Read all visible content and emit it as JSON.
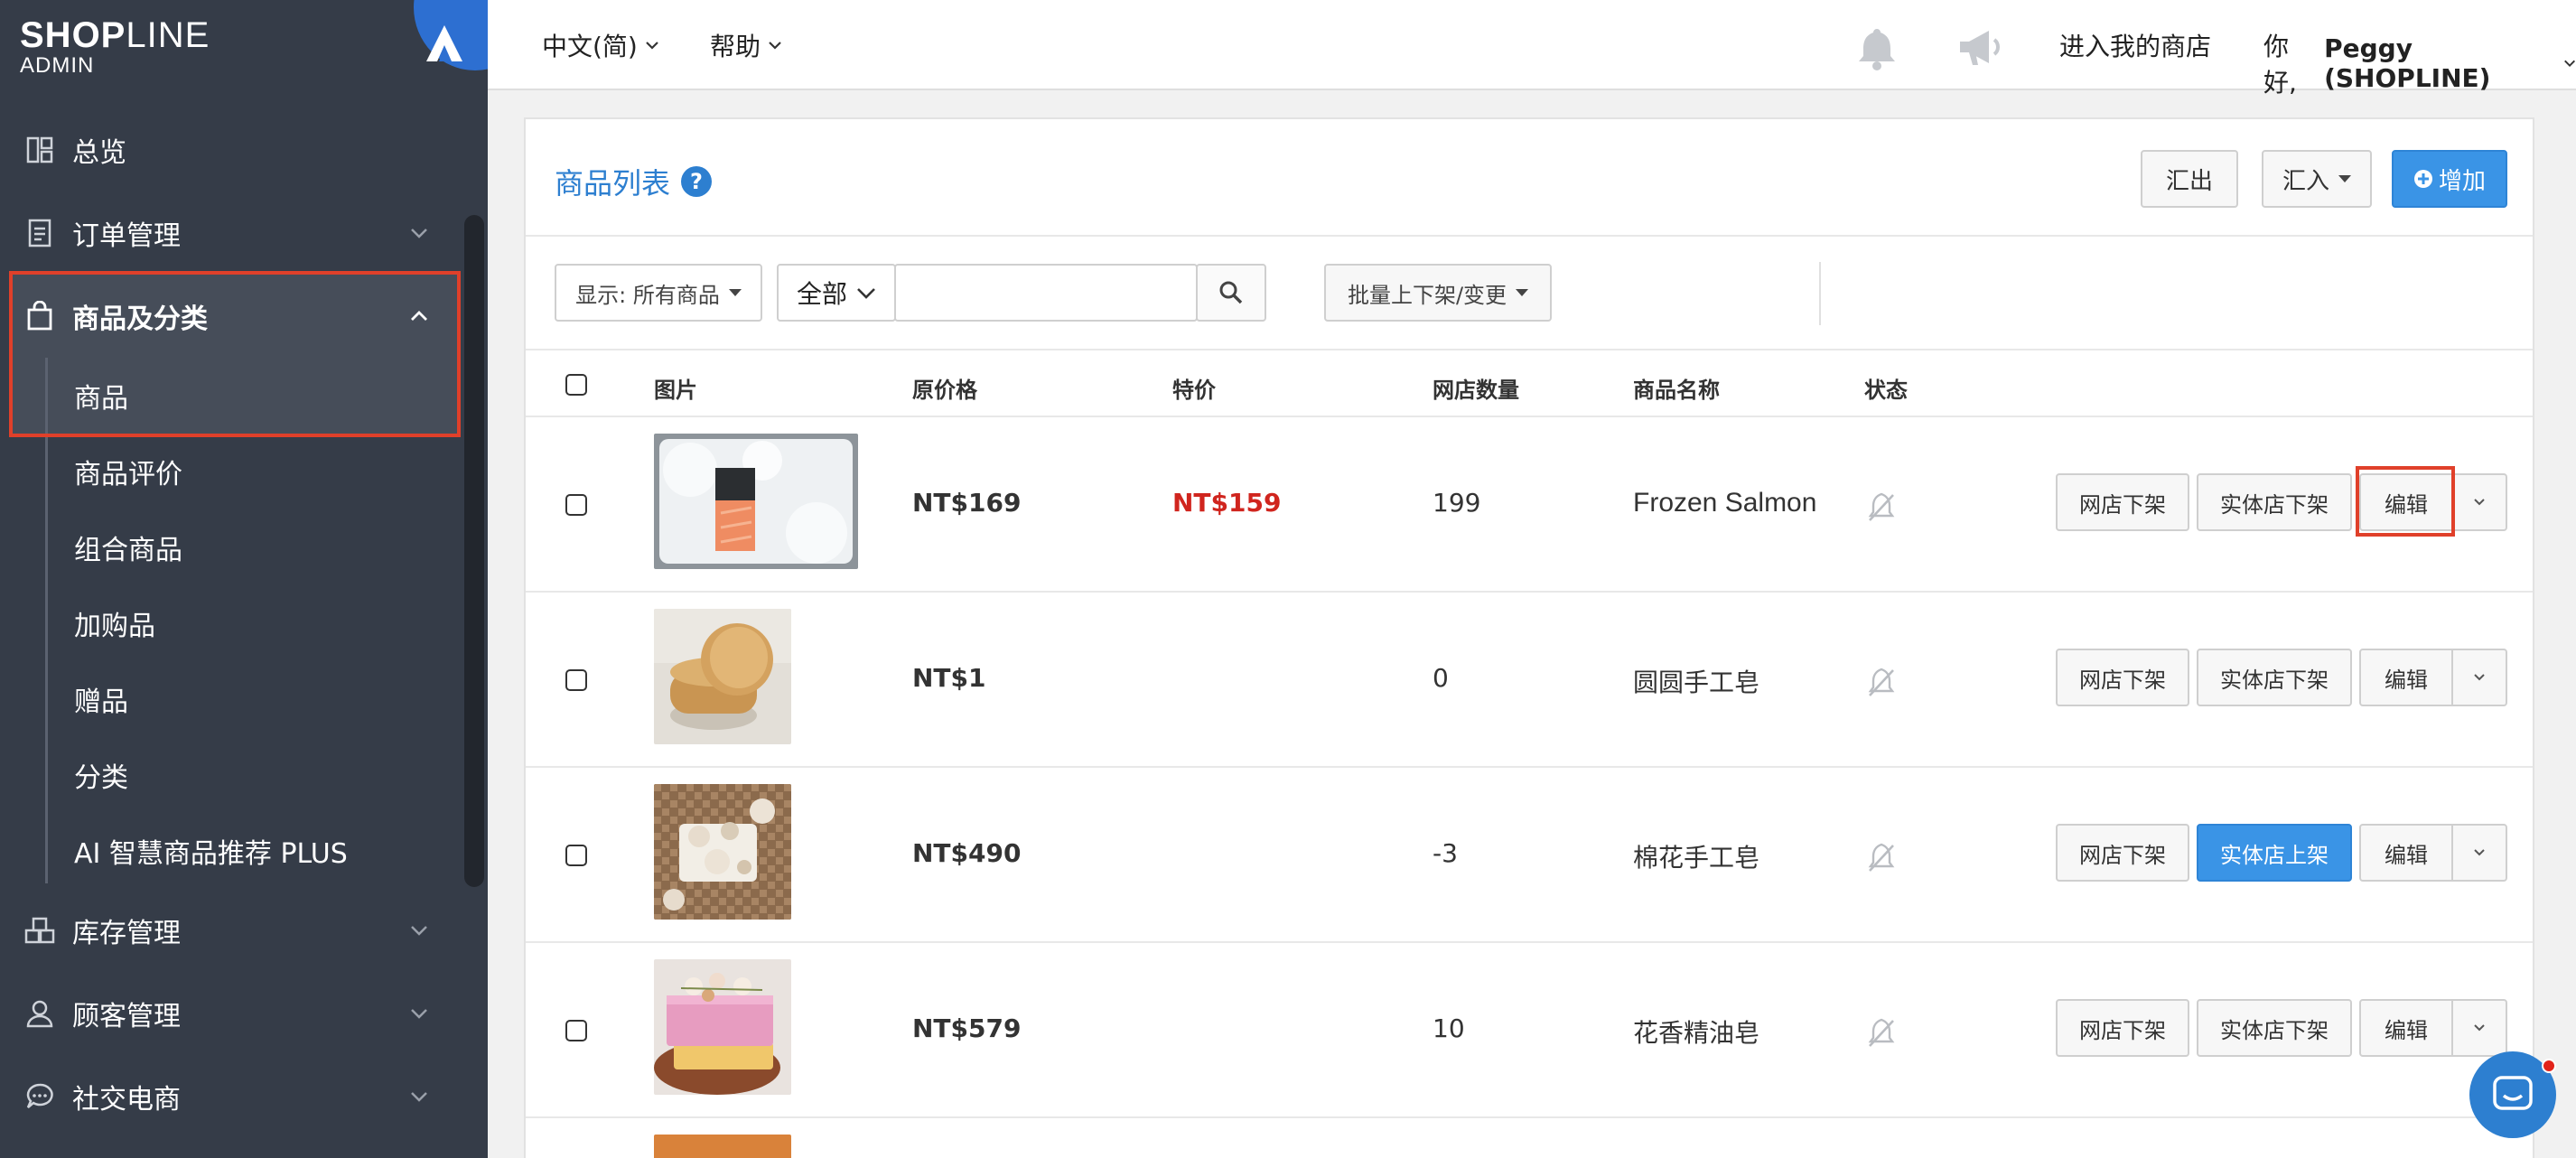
{
  "brand": {
    "name_bold": "SHOP",
    "name_light": "LINE",
    "sub": "ADMIN"
  },
  "sidebar": {
    "items": [
      {
        "label": "总览",
        "icon": "dashboard-icon"
      },
      {
        "label": "订单管理",
        "icon": "order-icon"
      },
      {
        "label": "商品及分类",
        "icon": "bag-icon",
        "expanded": true
      },
      {
        "label": "库存管理",
        "icon": "inventory-icon"
      },
      {
        "label": "顾客管理",
        "icon": "user-icon"
      },
      {
        "label": "社交电商",
        "icon": "chat-bubble-icon"
      }
    ],
    "sub_items": [
      {
        "label": "商品",
        "active": true
      },
      {
        "label": "商品评价"
      },
      {
        "label": "组合商品"
      },
      {
        "label": "加购品"
      },
      {
        "label": "赠品"
      },
      {
        "label": "分类"
      },
      {
        "label": "AI 智慧商品推荐 PLUS"
      }
    ]
  },
  "topbar": {
    "language": "中文(简)",
    "help": "帮助",
    "visit_store": "进入我的商店",
    "greeting": "你好,",
    "user": "Peggy (SHOPLINE)"
  },
  "panel": {
    "title": "商品列表",
    "help_glyph": "?",
    "export_label": "汇出",
    "import_label": "汇入",
    "add_label": "增加"
  },
  "filters": {
    "display_label": "显示: 所有商品",
    "scope_label": "全部",
    "search_value": "",
    "search_placeholder": "",
    "bulk_label": "批量上下架/变更"
  },
  "table": {
    "headers": {
      "image": "图片",
      "price": "原价格",
      "sale": "特价",
      "qty": "网店数量",
      "name": "商品名称",
      "status": "状态"
    },
    "rows": [
      {
        "price": "NT$169",
        "sale": "NT$159",
        "qty": "199",
        "name": "Frozen Salmon",
        "online_btn": "网店下架",
        "store_btn": "实体店下架",
        "store_primary": false,
        "edit_btn": "编辑"
      },
      {
        "price": "NT$1",
        "sale": "",
        "qty": "0",
        "name": "圆圆手工皂",
        "online_btn": "网店下架",
        "store_btn": "实体店下架",
        "store_primary": false,
        "edit_btn": "编辑"
      },
      {
        "price": "NT$490",
        "sale": "",
        "qty": "-3",
        "name": "棉花手工皂",
        "online_btn": "网店下架",
        "store_btn": "实体店上架",
        "store_primary": true,
        "edit_btn": "编辑"
      },
      {
        "price": "NT$579",
        "sale": "",
        "qty": "10",
        "name": "花香精油皂",
        "online_btn": "网店下架",
        "store_btn": "实体店下架",
        "store_primary": false,
        "edit_btn": "编辑"
      }
    ]
  },
  "colors": {
    "sidebar_bg": "#353c48",
    "accent": "#2d7fd0",
    "primary_btn": "#3a94e6",
    "highlight": "#e0402a",
    "sale_red": "#d0251e"
  }
}
